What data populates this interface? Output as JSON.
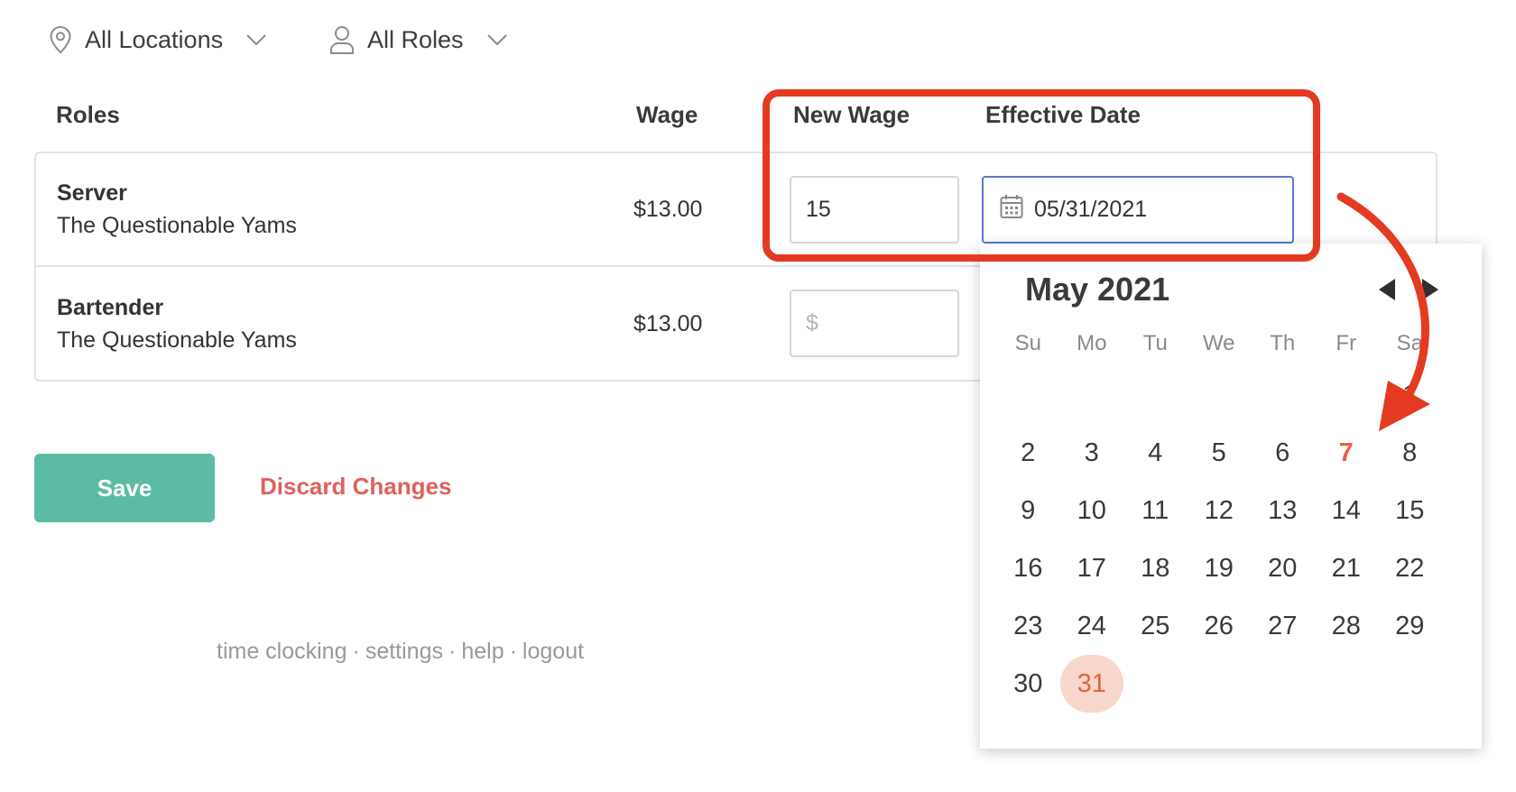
{
  "filters": {
    "locations": {
      "label": "All Locations",
      "icon": "location-pin-icon"
    },
    "roles": {
      "label": "All Roles",
      "icon": "user-icon"
    }
  },
  "table": {
    "headers": {
      "roles": "Roles",
      "wage": "Wage",
      "new_wage": "New Wage",
      "effective_date": "Effective Date"
    },
    "rows": [
      {
        "role": "Server",
        "location": "The Questionable Yams",
        "wage": "$13.00",
        "new_wage": "15",
        "new_wage_placeholder": "$",
        "effective_date": "05/31/2021"
      },
      {
        "role": "Bartender",
        "location": "The Questionable Yams",
        "wage": "$13.00",
        "new_wage": "",
        "new_wage_placeholder": "$"
      }
    ]
  },
  "actions": {
    "save": "Save",
    "discard": "Discard Changes"
  },
  "footer": {
    "links": [
      "time clocking",
      "settings",
      "help",
      "logout"
    ],
    "separator": "·"
  },
  "calendar": {
    "month_label": "May 2021",
    "weekdays": [
      "Su",
      "Mo",
      "Tu",
      "We",
      "Th",
      "Fr",
      "Sa"
    ],
    "leading_blanks": 6,
    "days_in_month": 31,
    "today": 7,
    "selected": 31
  },
  "colors": {
    "accent": "#5cbba5",
    "discard": "#e0605a",
    "annotation": "#e53a22",
    "today": "#e8633b",
    "selected_bg": "#f7d6cc",
    "focus_border": "#5b78d6"
  }
}
